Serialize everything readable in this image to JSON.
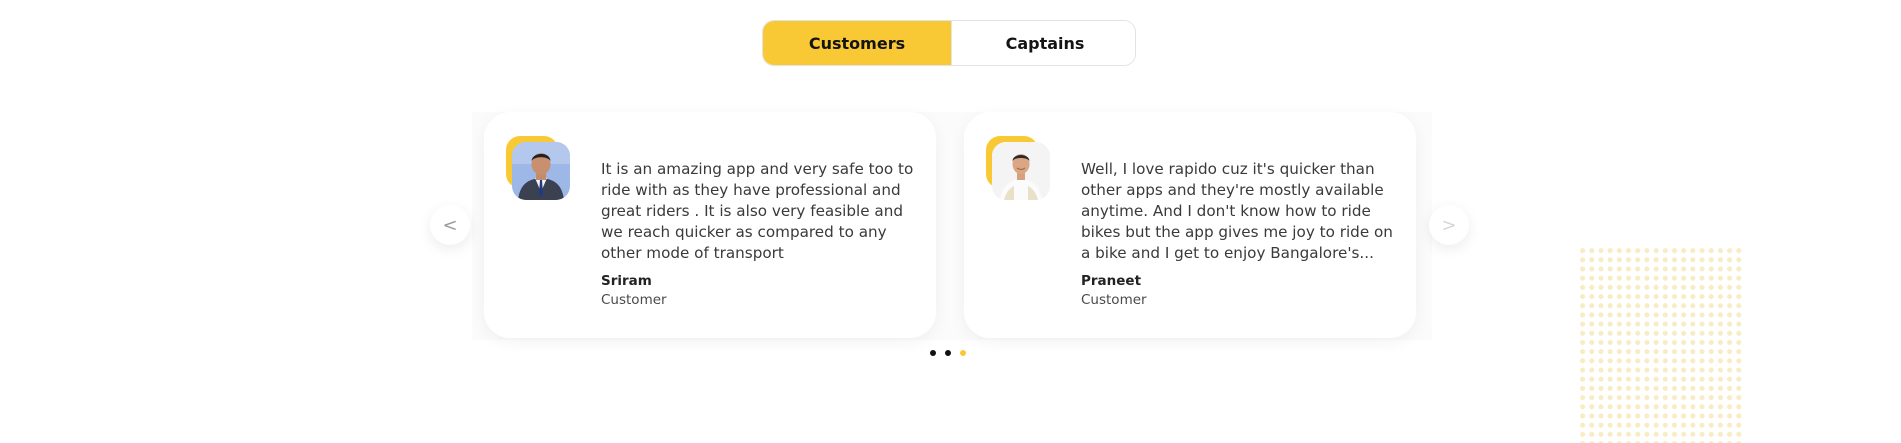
{
  "tabs": [
    {
      "label": "Customers",
      "active": true
    },
    {
      "label": "Captains",
      "active": false
    }
  ],
  "carousel": {
    "prev_label": "<",
    "next_label": ">",
    "testimonials": [
      {
        "quote": "It is an amazing app and very safe too to ride with as they have professional and great riders . It is also very feasible and we reach quicker as compared to any other mode of transport",
        "name": "Sriram",
        "role": "Customer"
      },
      {
        "quote": "Well, I love rapido cuz it's quicker than other apps and they're mostly available anytime. And I don't know how to ride bikes but the app gives me joy to ride on a bike and I get to enjoy Bangalore's...",
        "name": "Praneet",
        "role": "Customer"
      }
    ],
    "pagination": {
      "total": 3,
      "active_index": 2
    }
  },
  "colors": {
    "accent": "#f9c935",
    "text": "#3a3a3a",
    "dot_inactive": "#111111"
  }
}
